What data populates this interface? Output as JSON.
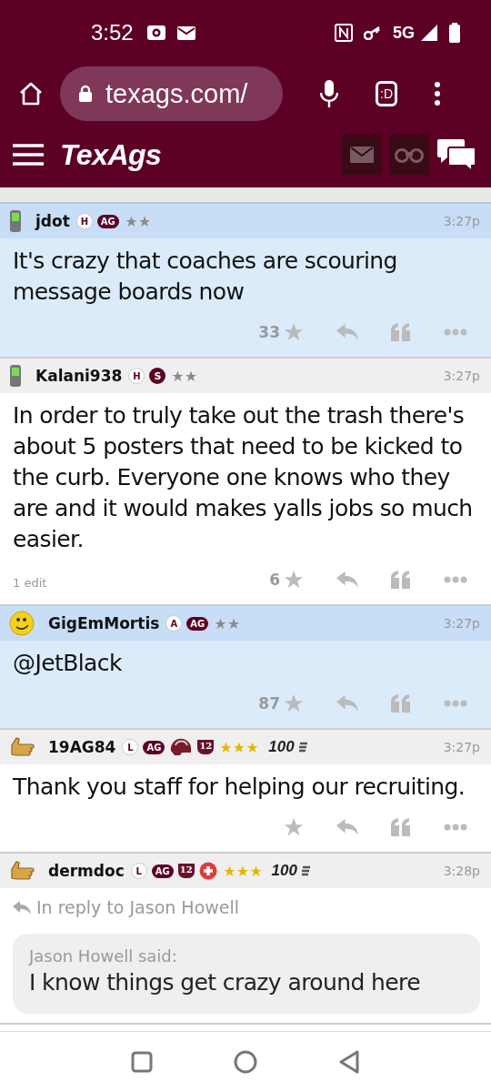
{
  "status_bar": {
    "time": "3:52",
    "network": "5G"
  },
  "browser": {
    "url": "texags.com/",
    "tab_icon": ":D"
  },
  "site_header": {
    "logo": "TexAgs"
  },
  "posts": [
    {
      "avatar": {
        "kind": "phone"
      },
      "username": "jdot",
      "badges": [
        {
          "kind": "letter",
          "text": "H"
        },
        {
          "kind": "pill",
          "text": "AG"
        }
      ],
      "membership": {
        "kind": "silver"
      },
      "time": "3:27p",
      "highlighted": true,
      "body": "It's crazy that coaches are scouring message boards now",
      "likes": "33"
    },
    {
      "avatar": {
        "kind": "phone"
      },
      "username": "Kalani938",
      "badges": [
        {
          "kind": "letter",
          "text": "H"
        },
        {
          "kind": "dot",
          "text": "S"
        }
      ],
      "membership": {
        "kind": "silver"
      },
      "time": "3:27p",
      "highlighted": false,
      "body": "In order to truly take out the trash there's about 5 posters that need to be kicked to the curb. Everyone one knows who they are and it would makes yalls jobs so much easier.",
      "likes": "6",
      "edit_note": "1 edit"
    },
    {
      "avatar": {
        "kind": "smiley"
      },
      "username": "GigEmMortis",
      "badges": [
        {
          "kind": "letter",
          "text": "A"
        },
        {
          "kind": "pill",
          "text": "AG"
        }
      ],
      "membership": {
        "kind": "silver"
      },
      "time": "3:27p",
      "highlighted": true,
      "body": "@JetBlack",
      "likes": "87"
    },
    {
      "avatar": {
        "kind": "thumb"
      },
      "username": "19AG84",
      "badges": [
        {
          "kind": "letter",
          "text": "L"
        },
        {
          "kind": "pill",
          "text": "AG"
        },
        {
          "kind": "helmet"
        },
        {
          "kind": "shield",
          "text": "12"
        }
      ],
      "membership": {
        "kind": "gold"
      },
      "rank": "100",
      "time": "3:27p",
      "highlighted": false,
      "body": "Thank you staff for helping our recruiting."
    },
    {
      "avatar": {
        "kind": "thumb"
      },
      "username": "dermdoc",
      "badges": [
        {
          "kind": "letter",
          "text": "L"
        },
        {
          "kind": "pill",
          "text": "AG"
        },
        {
          "kind": "shield",
          "text": "12"
        },
        {
          "kind": "cross"
        }
      ],
      "membership": {
        "kind": "gold"
      },
      "rank": "100",
      "time": "3:28p",
      "highlighted": false,
      "reply_to": "In reply to Jason Howell",
      "quote": {
        "author": "Jason Howell said:",
        "text": "I know things get crazy around here"
      }
    }
  ]
}
